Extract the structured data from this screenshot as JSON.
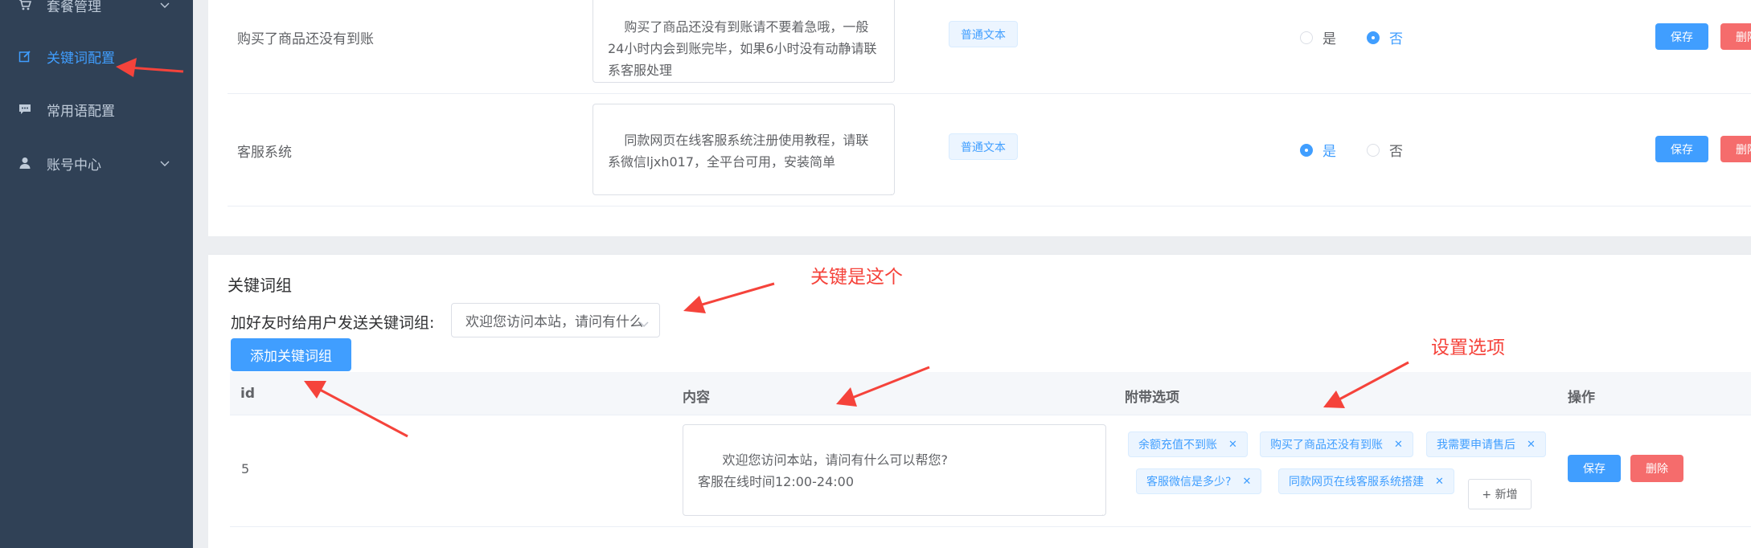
{
  "sidebar": {
    "items": [
      {
        "label": "套餐管理",
        "icon": "cart-icon",
        "has_chevron": true,
        "active": false
      },
      {
        "label": "关键词配置",
        "icon": "edit-icon",
        "has_chevron": false,
        "active": true
      },
      {
        "label": "常用语配置",
        "icon": "chat-icon",
        "has_chevron": false,
        "active": false
      },
      {
        "label": "账号中心",
        "icon": "user-icon",
        "has_chevron": true,
        "active": false
      }
    ]
  },
  "keywords": {
    "rows": [
      {
        "name": "购买了商品还没有到账",
        "content": "购买了商品还没有到账请不要着急哦，一般24小时内会到账完毕，如果6小时没有动静请联系客服处理",
        "type_tag": "普通文本",
        "radio_yes": "是",
        "radio_no": "否",
        "selected": "否",
        "save_label": "保存",
        "delete_label": "删除"
      },
      {
        "name": "客服系统",
        "content": "同款网页在线客服系统注册使用教程，请联系微信ljxh017，全平台可用，安装简单",
        "type_tag": "普通文本",
        "radio_yes": "是",
        "radio_no": "否",
        "selected": "是",
        "save_label": "保存",
        "delete_label": "删除"
      }
    ]
  },
  "group": {
    "title": "关键词组",
    "form_label": "加好友时给用户发送关键词组:",
    "select_value": "欢迎您访问本站，请问有什么",
    "add_button": "添加关键词组",
    "table": {
      "headers": [
        "id",
        "内容",
        "附带选项",
        "操作"
      ],
      "rows": [
        {
          "id": "5",
          "content": "欢迎您访问本站，请问有什么可以帮您?\n客服在线时间12:00-24:00",
          "options": [
            "余额充值不到账",
            "购买了商品还没有到账",
            "我需要申请售后",
            "客服微信是多少?",
            "同款网页在线客服系统搭建"
          ],
          "add_option": "+ 新增",
          "save_label": "保存",
          "delete_label": "删除"
        }
      ]
    }
  },
  "annotations": {
    "key_note": "关键是这个",
    "settings_note": "设置选项",
    "arrow_color": "#f5433b"
  },
  "colors": {
    "sidebar_bg": "#304156",
    "accent": "#409eff",
    "danger": "#f56c6c"
  }
}
